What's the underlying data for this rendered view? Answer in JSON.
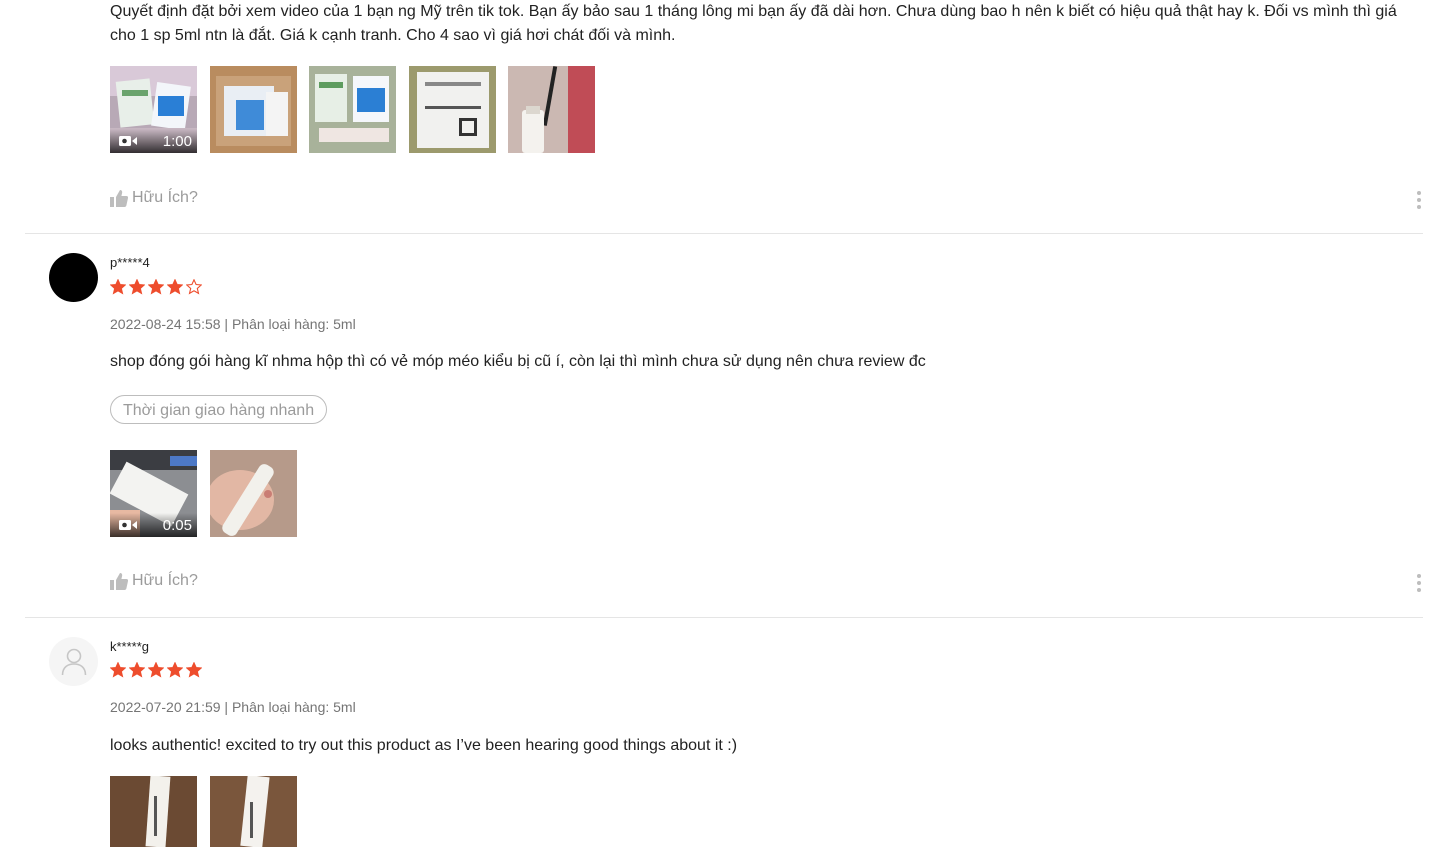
{
  "reviews": [
    {
      "comment": "Quyết định đặt bởi xem video của 1 bạn ng Mỹ trên tik tok. Bạn ấy bảo sau 1 tháng lông mi bạn ấy đã dài hơn. Chưa dùng bao h nên k biết có hiệu quả thật hay k. Đối vs mình thì giá cho 1 sp 5ml ntn là đắt. Giá k cạnh tranh. Cho 4 sao vì giá hơi chát đối và mình.",
      "video_duration": "1:00",
      "helpful_label": "Hữu Ích?"
    },
    {
      "username": "p*****4",
      "rating": 4,
      "meta": "2022-08-24 15:58 | Phân loại hàng: 5ml",
      "comment": "shop đóng gói hàng kĩ nhma hộp thì có vẻ móp méo kiểu bị cũ í, còn lại thì mình chưa sử dụng nên chưa review đc",
      "tag": "Thời gian giao hàng nhanh",
      "video_duration": "0:05",
      "helpful_label": "Hữu Ích?"
    },
    {
      "username": "k*****g",
      "rating": 5,
      "meta": "2022-07-20 21:59 | Phân loại hàng: 5ml",
      "comment": "looks authentic! excited to try out this product as I’ve been hearing good things about it :)"
    }
  ],
  "colors": {
    "star": "#ee4d2d",
    "muted": "#9b9b9b",
    "divider": "#e5e5e5"
  },
  "icons": {
    "helpful": "thumbs-up-icon",
    "more": "more-vertical-icon",
    "video": "video-camera-icon",
    "avatar": "default-user-icon"
  }
}
